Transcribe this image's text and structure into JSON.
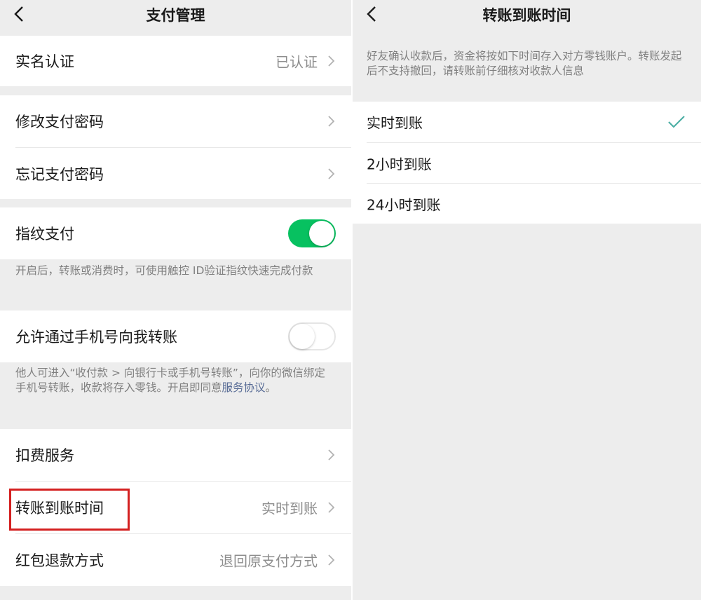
{
  "left_screen": {
    "title": "支付管理",
    "groups": {
      "real_name": {
        "label": "实名认证",
        "value": "已认证"
      },
      "password": {
        "change_label": "修改支付密码",
        "forgot_label": "忘记支付密码"
      },
      "fingerprint": {
        "label": "指纹支付",
        "enabled": true,
        "note": "开启后，转账或消费时，可使用触控 ID验证指纹快速完成付款"
      },
      "phone_transfer": {
        "label": "允许通过手机号向我转账",
        "enabled": false,
        "note_part1": "他人可进入“收付款 > 向银行卡或手机号转账”，向你的微信绑定手机号转账，收款将存入零钱。开启即同意",
        "note_link": "服务协议",
        "note_part2": "。"
      },
      "services": {
        "deduction_label": "扣费服务",
        "transfer_time_label": "转账到账时间",
        "transfer_time_value": "实时到账",
        "refund_label": "红包退款方式",
        "refund_value": "退回原支付方式"
      }
    }
  },
  "right_screen": {
    "title": "转账到账时间",
    "note": "好友确认收款后，资金将按如下时间存入对方零钱账户。转账发起后不支持撤回，请转账前仔细核对收款人信息",
    "options": [
      {
        "label": "实时到账",
        "selected": true
      },
      {
        "label": "2小时到账",
        "selected": false
      },
      {
        "label": "24小时到账",
        "selected": false
      }
    ]
  },
  "colors": {
    "toggle_on": "#07c160",
    "check": "#4fb0a6",
    "highlight": "#d42020",
    "link": "#576b95"
  },
  "icons": [
    "back-arrow-icon",
    "chevron-right-icon",
    "checkmark-icon"
  ]
}
